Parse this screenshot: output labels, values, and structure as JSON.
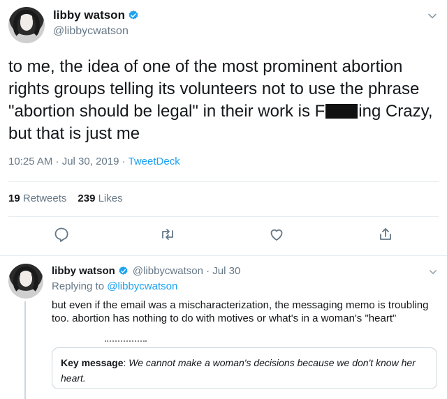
{
  "main_tweet": {
    "display_name": "libby watson",
    "handle": "@libbycwatson",
    "text_before": "to me, the idea of one of the most prominent abortion rights groups telling its volunteers not to use the phrase \"abortion should be legal\" in their work is F",
    "text_after": "ing Crazy, but that is just me",
    "timestamp": "10:25 AM · Jul 30, 2019 · ",
    "source": "TweetDeck",
    "retweets_count": "19",
    "retweets_label": "Retweets",
    "likes_count": "239",
    "likes_label": "Likes",
    "icons": {
      "verified": "verified-badge-icon",
      "caret": "chevron-down-icon",
      "reply": "reply-icon",
      "retweet": "retweet-icon",
      "like": "heart-icon",
      "share": "share-icon"
    }
  },
  "reply_tweet": {
    "display_name": "libby watson",
    "handle_and_date": "@libbycwatson · Jul 30",
    "replying_prefix": "Replying to ",
    "replying_to": "@libbycwatson",
    "text": "but even if the email was a mischaracterization, the messaging memo is troubling too. abortion has nothing to do with motives or what's in a woman's \"heart\"",
    "quote_key": "Key message",
    "quote_colon": ": ",
    "quote_body": "We cannot make a woman's decisions because we don't know her heart."
  },
  "colors": {
    "text": "#14171a",
    "muted": "#657786",
    "link": "#1da1f2",
    "border": "#e6ecf0"
  }
}
